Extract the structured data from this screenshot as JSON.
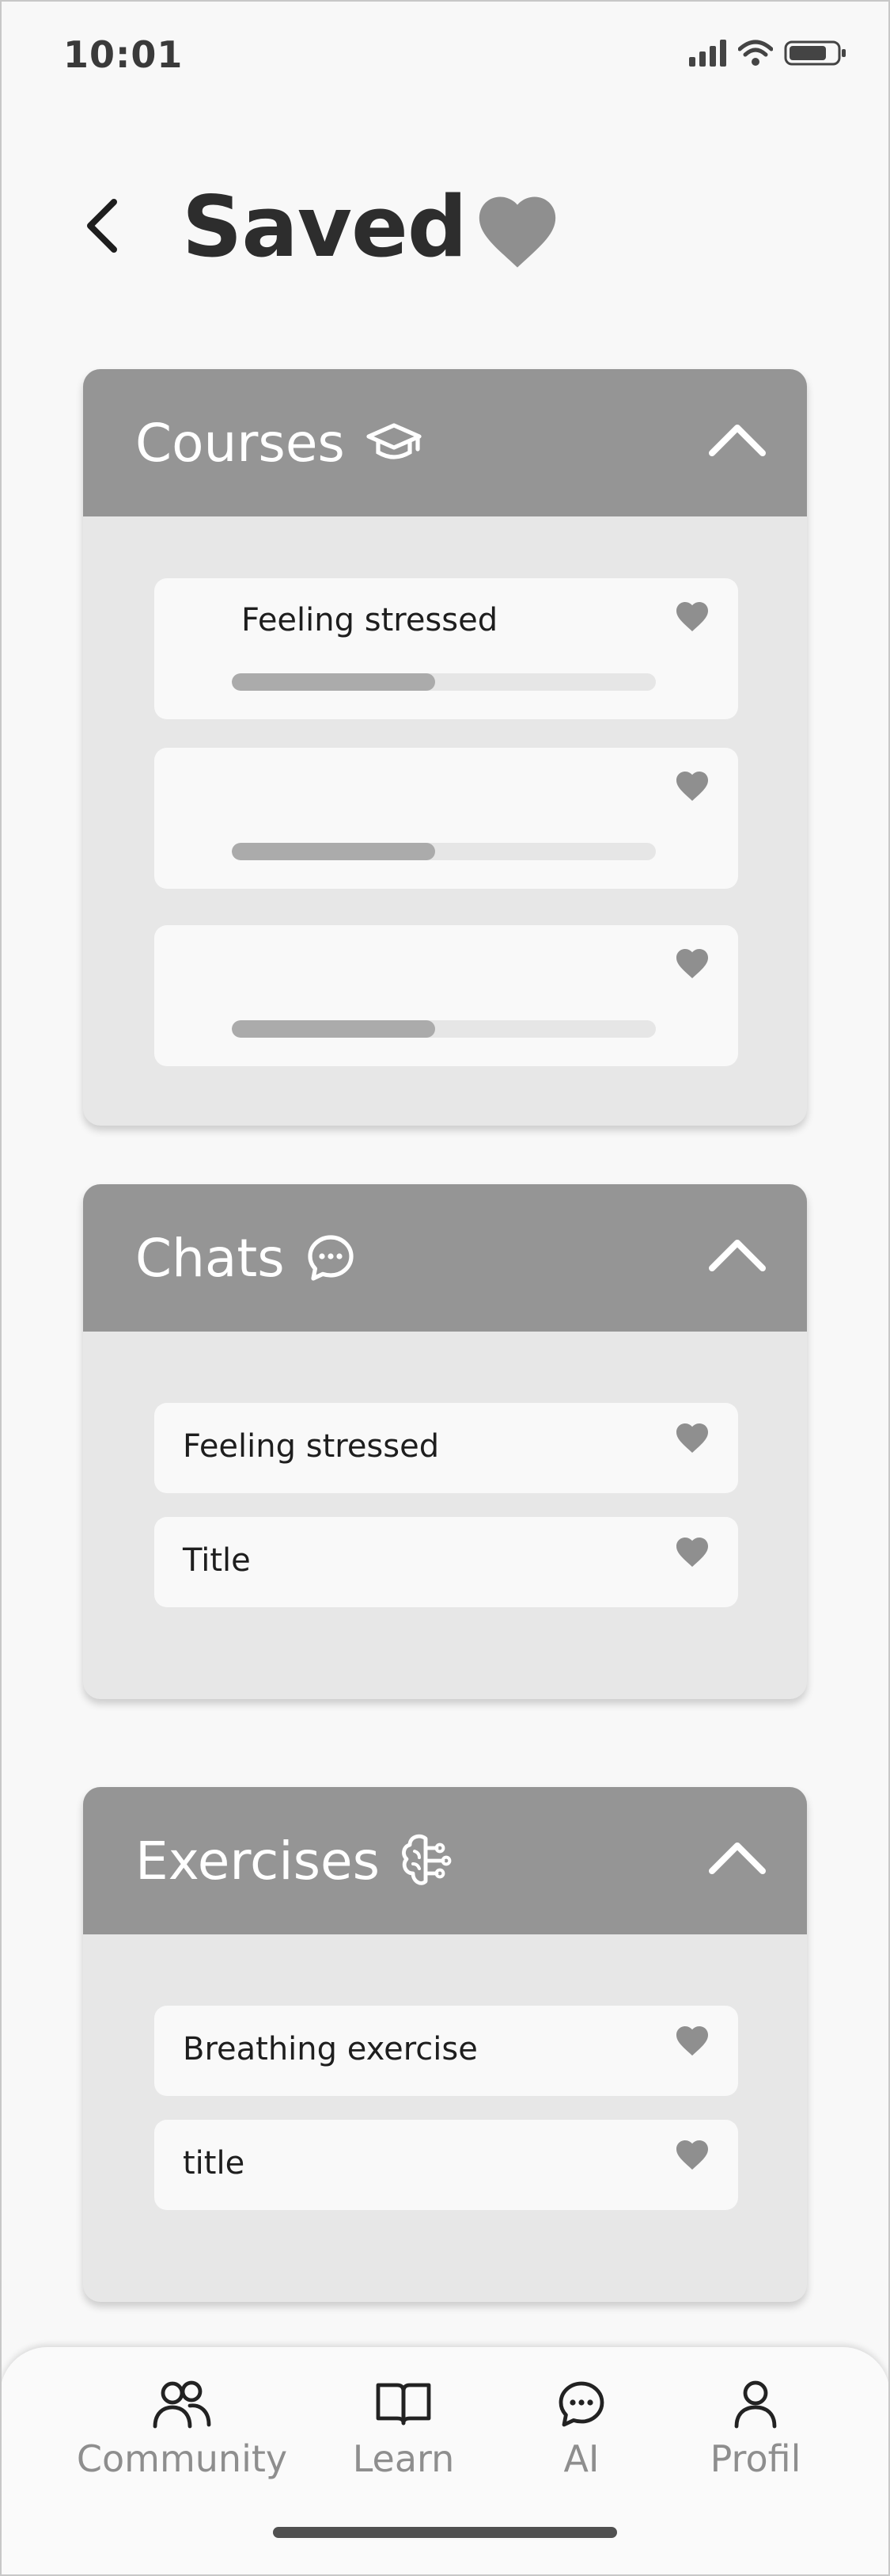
{
  "status_bar": {
    "time": "10:01"
  },
  "header": {
    "title": "Saved"
  },
  "sections": {
    "courses": {
      "title": "Courses",
      "items": [
        {
          "title": "Feeling stressed",
          "progress": 0.48
        },
        {
          "title": "",
          "progress": 0.48
        },
        {
          "title": "",
          "progress": 0.48
        }
      ]
    },
    "chats": {
      "title": "Chats",
      "items": [
        {
          "title": "Feeling stressed"
        },
        {
          "title": "Title"
        }
      ]
    },
    "exercises": {
      "title": "Exercises",
      "items": [
        {
          "title": "Breathing exercise"
        },
        {
          "title": "title"
        }
      ]
    }
  },
  "bottom_nav": {
    "items": [
      {
        "label": "Community",
        "icon": "community-icon"
      },
      {
        "label": "Learn",
        "icon": "book-icon"
      },
      {
        "label": "AI",
        "icon": "chat-bubble-icon"
      },
      {
        "label": "Profil",
        "icon": "user-icon"
      }
    ]
  },
  "colors": {
    "section_header": "#959595",
    "section_body": "#e7e7e7",
    "card": "#f9f9f9",
    "heart": "#8f8f8f",
    "nav_label": "#8e8e8e"
  }
}
